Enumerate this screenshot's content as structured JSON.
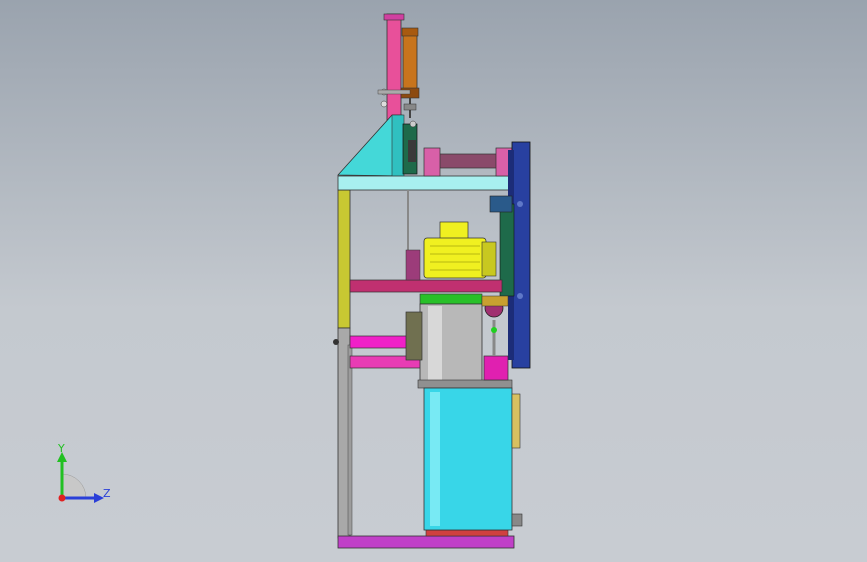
{
  "viewport": {
    "background_top": "#9aa3ae",
    "background_bottom": "#c8ccd2"
  },
  "triad": {
    "y_label": "Y",
    "z_label": "Z",
    "y_color": "#22c022",
    "z_color": "#2a3fd8",
    "x_color": "#e02020"
  },
  "colors": {
    "frame_yellow": "#c8c832",
    "frame_gray": "#a9a9a9",
    "top_plate": "#a8f0f0",
    "bracket": "#44d8d8",
    "pink_column": "#e8509a",
    "cylinder": "#c8741c",
    "motor_yellow": "#f0f020",
    "tank_body": "#38d6e8",
    "tank_steel": "#b8b8b8",
    "tank_green_rim": "#28c028",
    "blue_plate": "#2840a0",
    "base_rail": "#c040c8",
    "magenta_block": "#e020b0",
    "dark_green": "#1e6a4a"
  }
}
